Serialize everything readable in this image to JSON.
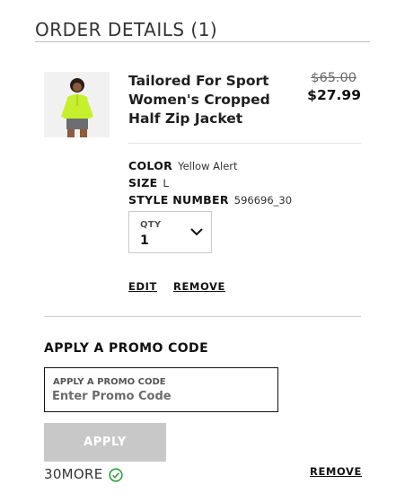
{
  "header": {
    "title": "ORDER DETAILS (1)"
  },
  "item": {
    "image_alt": "product-photo",
    "name": "Tailored For Sport Women's Cropped Half Zip Jacket",
    "price_original": "$65.00",
    "price_sale": "$27.99",
    "attributes": [
      {
        "key": "COLOR",
        "value": "Yellow Alert"
      },
      {
        "key": "SIZE",
        "value": "L"
      },
      {
        "key": "STYLE NUMBER",
        "value": "596696_30"
      }
    ],
    "qty": {
      "label": "QTY",
      "value": "1"
    },
    "actions": {
      "edit": "EDIT",
      "remove": "REMOVE"
    }
  },
  "promo": {
    "title": "APPLY A PROMO CODE",
    "field_label": "APPLY A PROMO CODE",
    "placeholder": "Enter Promo Code",
    "apply_label": "APPLY",
    "applied_code": "30MORE",
    "remove_label": "REMOVE"
  },
  "colors": {
    "product": "#c6f02c",
    "success": "#2e9d3c",
    "disabled": "#c8c8c8"
  }
}
